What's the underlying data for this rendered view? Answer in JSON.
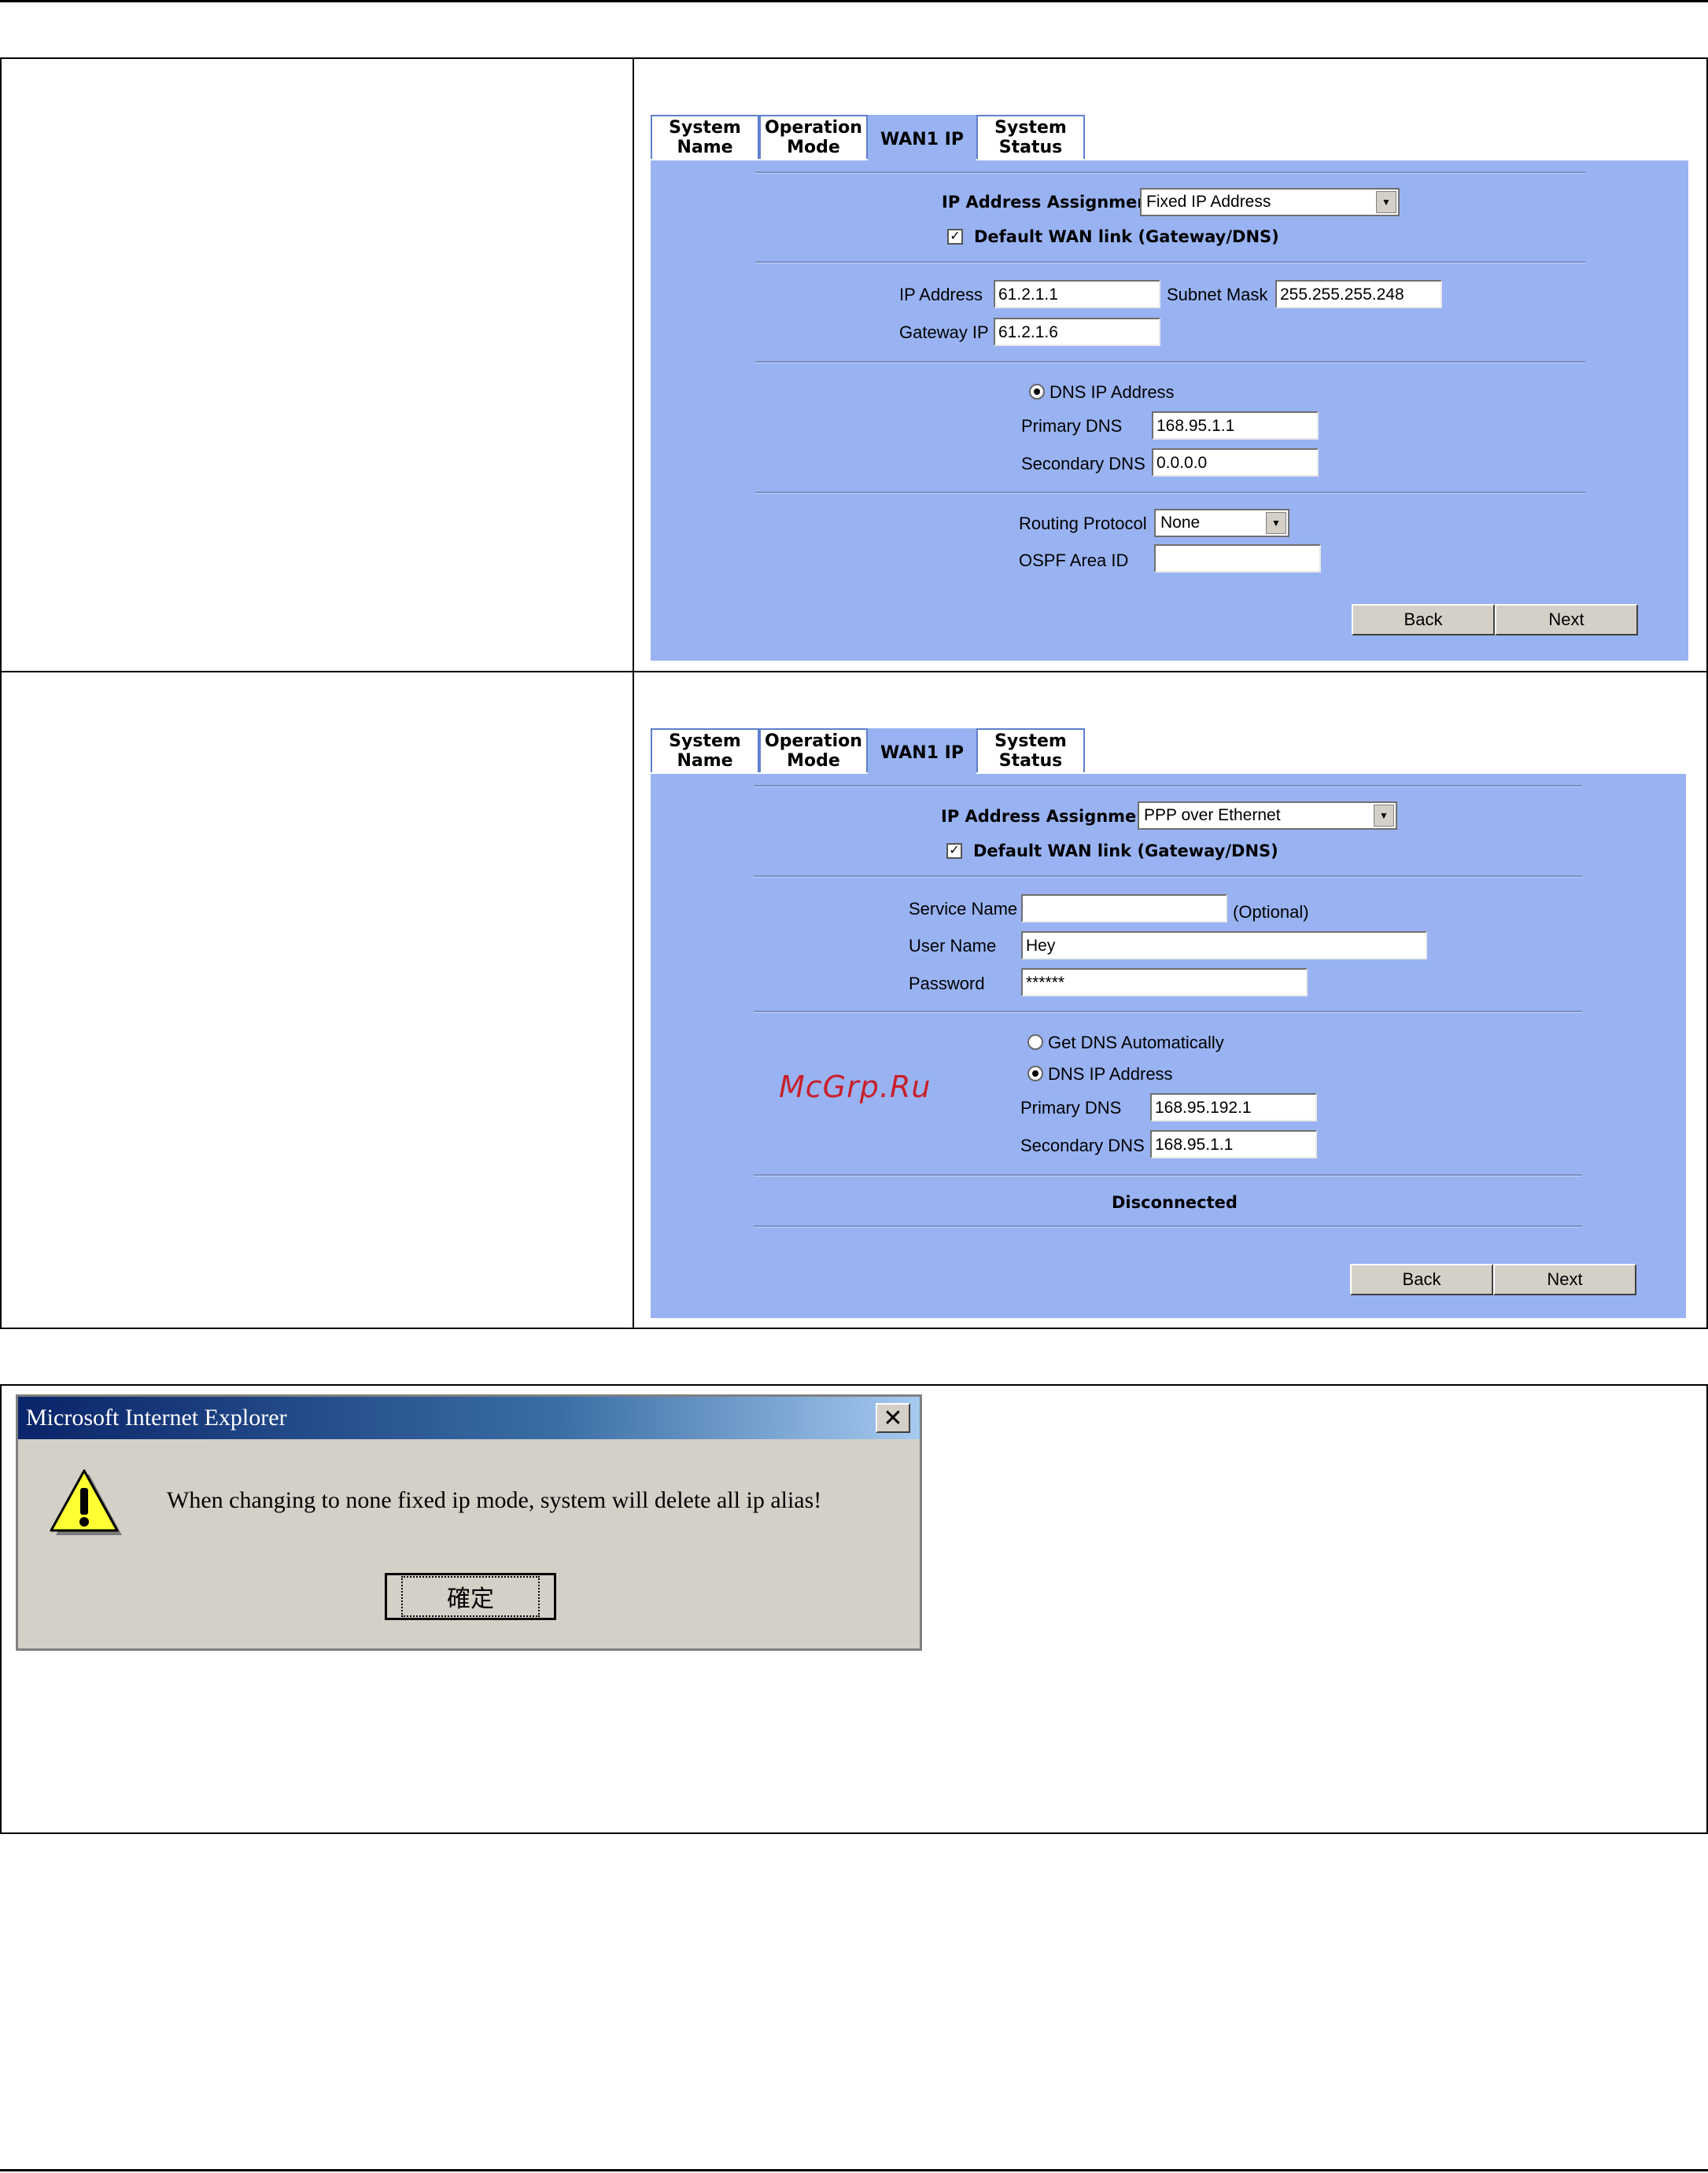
{
  "panel1": {
    "tabs": [
      {
        "line1": "System",
        "line2": "Name"
      },
      {
        "line1": "Operation",
        "line2": "Mode"
      },
      {
        "line1": "WAN1 IP",
        "line2": ""
      },
      {
        "line1": "System",
        "line2": "Status"
      }
    ],
    "ip_assignment_label": "IP Address Assignment",
    "ip_assignment_value": "Fixed IP Address",
    "default_wan_label": "Default WAN link (Gateway/DNS)",
    "ip_address_label": "IP Address",
    "ip_address_value": "61.2.1.1",
    "subnet_mask_label": "Subnet Mask",
    "subnet_mask_value": "255.255.255.248",
    "gateway_ip_label": "Gateway IP",
    "gateway_ip_value": "61.2.1.6",
    "dns_ip_label": "DNS IP Address",
    "primary_dns_label": "Primary DNS",
    "primary_dns_value": "168.95.1.1",
    "secondary_dns_label": "Secondary DNS",
    "secondary_dns_value": "0.0.0.0",
    "routing_protocol_label": "Routing Protocol",
    "routing_protocol_value": "None",
    "ospf_label": "OSPF Area ID",
    "ospf_value": "",
    "back_label": "Back",
    "next_label": "Next"
  },
  "panel2": {
    "tabs": [
      {
        "line1": "System",
        "line2": "Name"
      },
      {
        "line1": "Operation",
        "line2": "Mode"
      },
      {
        "line1": "WAN1 IP",
        "line2": ""
      },
      {
        "line1": "System",
        "line2": "Status"
      }
    ],
    "ip_assignment_label": "IP Address Assignment",
    "ip_assignment_value": "PPP over Ethernet",
    "default_wan_label": "Default WAN link (Gateway/DNS)",
    "service_name_label": "Service Name",
    "service_name_value": "",
    "optional_label": "(Optional)",
    "user_name_label": "User Name",
    "user_name_value": "Hey",
    "password_label": "Password",
    "password_value": "******",
    "get_dns_auto_label": "Get DNS Automatically",
    "dns_ip_label": "DNS IP Address",
    "primary_dns_label": "Primary DNS",
    "primary_dns_value": "168.95.192.1",
    "secondary_dns_label": "Secondary DNS",
    "secondary_dns_value": "168.95.1.1",
    "status_text": "Disconnected",
    "back_label": "Back",
    "next_label": "Next"
  },
  "watermark": "McGrp.Ru",
  "dialog": {
    "title": "Microsoft Internet Explorer",
    "message": "When changing to none fixed ip mode, system will delete all ip alias!",
    "ok_label": "確定"
  }
}
